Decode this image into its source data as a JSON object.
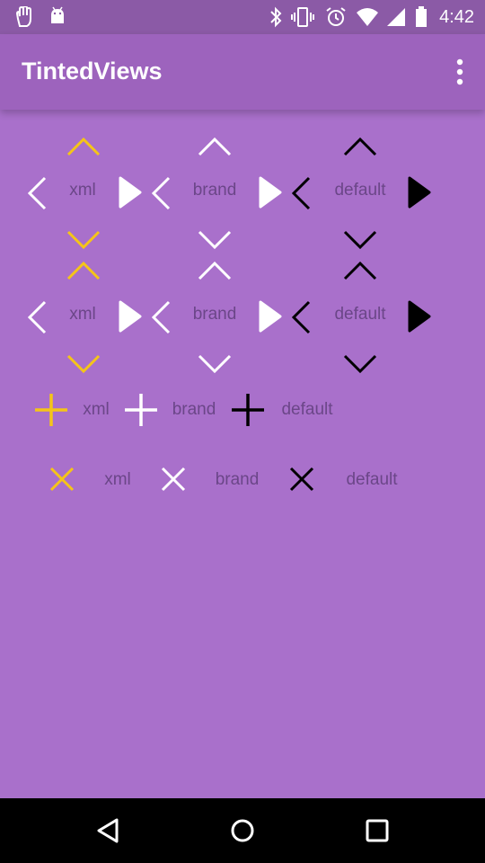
{
  "status_bar": {
    "time": "4:42",
    "left_icons": [
      "hand-icon",
      "android-icon"
    ],
    "right_icons": [
      "bluetooth-icon",
      "vibrate-icon",
      "alarm-icon",
      "wifi-icon",
      "signal-icon",
      "battery-icon"
    ]
  },
  "app_bar": {
    "title": "TintedViews",
    "overflow_icon": "more-vert-icon"
  },
  "colors": {
    "status_bar": "#8b5aa6",
    "app_bar": "#9d63bd",
    "background": "#a970cb",
    "xml_tint": "#f5c518",
    "brand_tint": "#ffffff",
    "default_tint": "#000000",
    "label_text": "#6b4688"
  },
  "arrow_groups_row1": [
    {
      "label": "xml"
    },
    {
      "label": "brand"
    },
    {
      "label": "default"
    }
  ],
  "arrow_groups_row2": [
    {
      "label": "xml"
    },
    {
      "label": "brand"
    },
    {
      "label": "default"
    }
  ],
  "plus_row": [
    {
      "label": "xml"
    },
    {
      "label": "brand"
    },
    {
      "label": "default"
    }
  ],
  "close_row": [
    {
      "label": "xml"
    },
    {
      "label": "brand"
    },
    {
      "label": "default"
    }
  ],
  "nav_bar": {
    "icons": [
      "back-icon",
      "home-icon",
      "recents-icon"
    ]
  }
}
